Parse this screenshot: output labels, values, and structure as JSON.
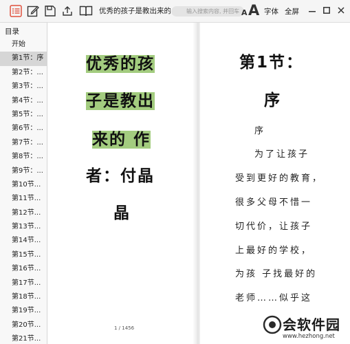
{
  "toolbar": {
    "doc_title": "优秀的孩子是教出来的：",
    "search_placeholder": "输入搜索内容, 并回车",
    "font_small": "A",
    "font_large": "A",
    "font_label": "字体",
    "fullscreen_label": "全屏",
    "icons": [
      "toc-list-icon",
      "edit-note-icon",
      "bookmark-icon",
      "share-icon",
      "book-icon",
      "minimize-icon",
      "maximize-icon",
      "close-icon"
    ],
    "accent": "#e0503c"
  },
  "sidebar": {
    "header": "目录",
    "items": [
      {
        "label": "开始",
        "active": false
      },
      {
        "label": "第1节：序",
        "active": true
      },
      {
        "label": "第2节：...",
        "active": false
      },
      {
        "label": "第3节：...",
        "active": false
      },
      {
        "label": "第4节：...",
        "active": false
      },
      {
        "label": "第5节：...",
        "active": false
      },
      {
        "label": "第6节：...",
        "active": false
      },
      {
        "label": "第7节：...",
        "active": false
      },
      {
        "label": "第8节：...",
        "active": false
      },
      {
        "label": "第9节：...",
        "active": false
      },
      {
        "label": "第10节...",
        "active": false
      },
      {
        "label": "第11节...",
        "active": false
      },
      {
        "label": "第12节...",
        "active": false
      },
      {
        "label": "第13节...",
        "active": false
      },
      {
        "label": "第14节...",
        "active": false
      },
      {
        "label": "第15节...",
        "active": false
      },
      {
        "label": "第16节...",
        "active": false
      },
      {
        "label": "第17节...",
        "active": false
      },
      {
        "label": "第18节...",
        "active": false
      },
      {
        "label": "第19节...",
        "active": false
      },
      {
        "label": "第20节...",
        "active": false
      },
      {
        "label": "第21节...",
        "active": false
      }
    ]
  },
  "left_page": {
    "cover_lines": [
      "优秀的孩",
      "子是教出",
      "来的 作",
      "者：付晶",
      "晶"
    ],
    "highlight_color": "#a3cc7f",
    "page_number": "1 / 1456"
  },
  "right_page": {
    "chapter_title_1": "第1节：",
    "chapter_title_2": "序",
    "body_lines": [
      "序",
      "为了让孩子",
      "受到更好的教育，",
      "很多父母不惜一",
      "切代价，让孩子",
      "上最好的学校，",
      "为孩 子找最好的",
      "老师……似乎这"
    ]
  },
  "watermark": {
    "text": "会软件园",
    "url": "www.hezhong.net"
  }
}
